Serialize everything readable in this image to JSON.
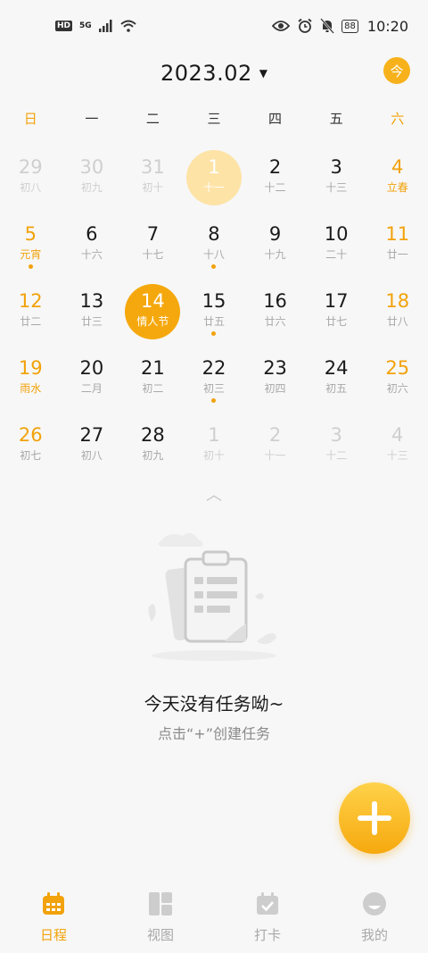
{
  "status_bar": {
    "hd": "HD",
    "net": "5G",
    "battery": "88",
    "time": "10:20"
  },
  "header": {
    "month": "2023.02",
    "today_label": "今"
  },
  "weekdays": [
    "日",
    "一",
    "二",
    "三",
    "四",
    "五",
    "六"
  ],
  "days": [
    {
      "d": "29",
      "l": "初八",
      "other": true
    },
    {
      "d": "30",
      "l": "初九",
      "other": true
    },
    {
      "d": "31",
      "l": "初十",
      "other": true
    },
    {
      "d": "1",
      "l": "十一",
      "today": true
    },
    {
      "d": "2",
      "l": "十二"
    },
    {
      "d": "3",
      "l": "十三"
    },
    {
      "d": "4",
      "l": "立春",
      "fest": true
    },
    {
      "d": "5",
      "l": "元宵",
      "fest": true,
      "dot": true
    },
    {
      "d": "6",
      "l": "十六"
    },
    {
      "d": "7",
      "l": "十七"
    },
    {
      "d": "8",
      "l": "十八",
      "dot": true
    },
    {
      "d": "9",
      "l": "十九"
    },
    {
      "d": "10",
      "l": "二十"
    },
    {
      "d": "11",
      "l": "廿一"
    },
    {
      "d": "12",
      "l": "廿二"
    },
    {
      "d": "13",
      "l": "廿三"
    },
    {
      "d": "14",
      "l": "情人节",
      "selected": true
    },
    {
      "d": "15",
      "l": "廿五",
      "dot": true
    },
    {
      "d": "16",
      "l": "廿六"
    },
    {
      "d": "17",
      "l": "廿七"
    },
    {
      "d": "18",
      "l": "廿八"
    },
    {
      "d": "19",
      "l": "雨水",
      "fest": true
    },
    {
      "d": "20",
      "l": "二月"
    },
    {
      "d": "21",
      "l": "初二"
    },
    {
      "d": "22",
      "l": "初三",
      "dot": true
    },
    {
      "d": "23",
      "l": "初四"
    },
    {
      "d": "24",
      "l": "初五"
    },
    {
      "d": "25",
      "l": "初六"
    },
    {
      "d": "26",
      "l": "初七"
    },
    {
      "d": "27",
      "l": "初八"
    },
    {
      "d": "28",
      "l": "初九"
    },
    {
      "d": "1",
      "l": "初十",
      "other": true
    },
    {
      "d": "2",
      "l": "十一",
      "other": true
    },
    {
      "d": "3",
      "l": "十二",
      "other": true
    },
    {
      "d": "4",
      "l": "十三",
      "other": true
    }
  ],
  "empty_state": {
    "title": "今天没有任务呦~",
    "subtitle": "点击“+”创建任务"
  },
  "nav": [
    {
      "label": "日程",
      "icon": "calendar-icon",
      "active": true
    },
    {
      "label": "视图",
      "icon": "grid-view-icon"
    },
    {
      "label": "打卡",
      "icon": "check-calendar-icon"
    },
    {
      "label": "我的",
      "icon": "profile-icon"
    }
  ],
  "colors": {
    "accent": "#f2a20a",
    "today_bubble": "#fde3a6",
    "selected_bubble": "#f5a80d",
    "muted": "#a8a8a8"
  }
}
